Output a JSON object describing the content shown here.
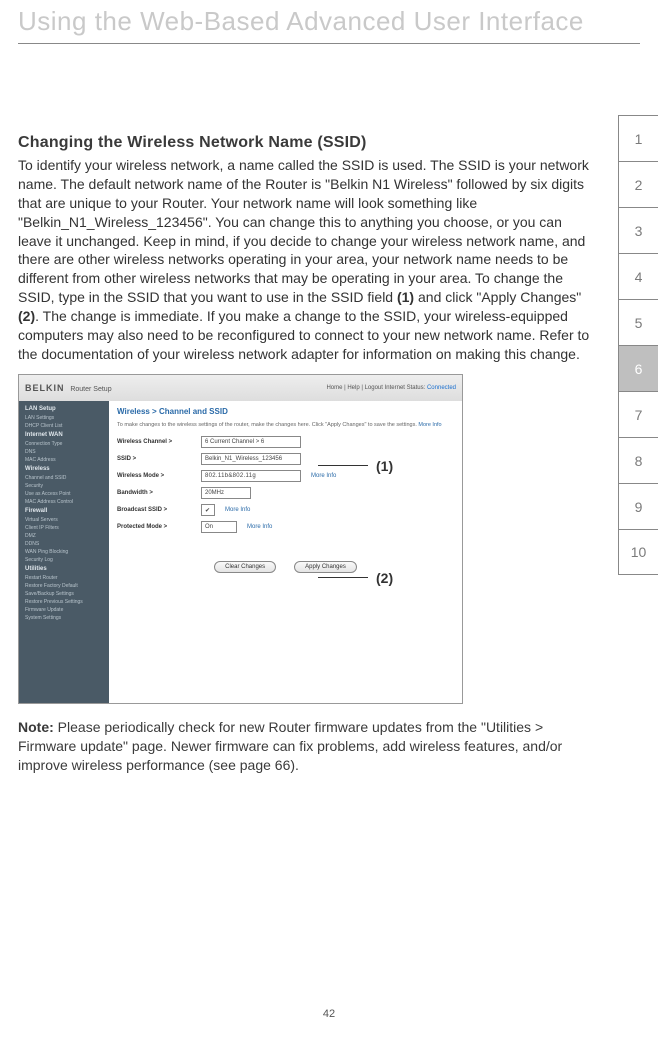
{
  "page_title": "Using the Web-Based Advanced User Interface",
  "page_number": "42",
  "side_tabs": [
    "1",
    "2",
    "3",
    "4",
    "5",
    "6",
    "7",
    "8",
    "9",
    "10"
  ],
  "active_tab_index": 5,
  "section": {
    "heading": "Changing the Wireless Network Name (SSID)",
    "para_pre": "To identify your wireless network, a name called the SSID  is used. The SSID is your network name. The default network name of the Router is \"Belkin N1 Wireless\" followed by six digits that are unique to your Router. Your network name will look something like \"Belkin_N1_Wireless_123456\". You can change this to anything you choose, or you can leave it unchanged. Keep in mind, if you decide to change your wireless network name, and there are other wireless networks operating in your area, your network name needs to be different from other wireless networks that may be operating in your area. To change the SSID, type in the SSID that you want to use in the SSID field ",
    "ref1": "(1)",
    "para_mid": " and click \"Apply Changes\" ",
    "ref2": "(2)",
    "para_post": ". The change is immediate. If you make a change to the SSID, your wireless-equipped computers may also need to be reconfigured to connect to your new network name. Refer to the documentation of your wireless network adapter for information on making this change."
  },
  "callouts": {
    "c1": "(1)",
    "c2": "(2)"
  },
  "router": {
    "brand": "BELKIN",
    "setup_label": "Router Setup",
    "top_right": "Home | Help | Logout   Internet Status:",
    "connected": "Connected",
    "sidebar": [
      {
        "type": "head",
        "text": "LAN Setup"
      },
      {
        "type": "item",
        "text": "LAN Settings"
      },
      {
        "type": "item",
        "text": "DHCP Client List"
      },
      {
        "type": "head",
        "text": "Internet WAN"
      },
      {
        "type": "item",
        "text": "Connection Type"
      },
      {
        "type": "item",
        "text": "DNS"
      },
      {
        "type": "item",
        "text": "MAC Address"
      },
      {
        "type": "head",
        "text": "Wireless"
      },
      {
        "type": "item",
        "text": "Channel and SSID"
      },
      {
        "type": "item",
        "text": "Security"
      },
      {
        "type": "item",
        "text": "Use as Access Point"
      },
      {
        "type": "item",
        "text": "MAC Address Control"
      },
      {
        "type": "head",
        "text": "Firewall"
      },
      {
        "type": "item",
        "text": "Virtual Servers"
      },
      {
        "type": "item",
        "text": "Client IP Filters"
      },
      {
        "type": "item",
        "text": "DMZ"
      },
      {
        "type": "item",
        "text": "DDNS"
      },
      {
        "type": "item",
        "text": "WAN Ping Blocking"
      },
      {
        "type": "item",
        "text": "Security Log"
      },
      {
        "type": "head",
        "text": "Utilities"
      },
      {
        "type": "item",
        "text": "Restart Router"
      },
      {
        "type": "item",
        "text": "Restore Factory Default"
      },
      {
        "type": "item",
        "text": "Save/Backup Settings"
      },
      {
        "type": "item",
        "text": "Restore Previous Settings"
      },
      {
        "type": "item",
        "text": "Firmware Update"
      },
      {
        "type": "item",
        "text": "System Settings"
      }
    ],
    "crumb": "Wireless > Channel and SSID",
    "helper_pre": "To make changes to the wireless settings of the router, make the changes here. Click \"Apply Changes\" to save the settings. ",
    "helper_more": "More Info",
    "rows": {
      "channel_label": "Wireless Channel >",
      "channel_value": "6   Current Channel >  6",
      "ssid_label": "SSID >",
      "ssid_value": "Belkin_N1_Wireless_123456",
      "mode_label": "Wireless Mode >",
      "mode_value": "802.11b&802.11g",
      "mode_more": "More Info",
      "bw_label": "Bandwidth >",
      "bw_value": "20MHz",
      "bcast_label": "Broadcast SSID >",
      "bcast_more": "More Info",
      "prot_label": "Protected Mode >",
      "prot_value": "On",
      "prot_more": "More Info"
    },
    "buttons": {
      "clear": "Clear Changes",
      "apply": "Apply Changes"
    }
  },
  "note": {
    "label": "Note:",
    "text": " Please periodically check for new Router firmware updates from the \"Utilities > Firmware update\" page. Newer firmware can fix problems, add wireless features, and/or improve wireless performance (see page 66)."
  }
}
